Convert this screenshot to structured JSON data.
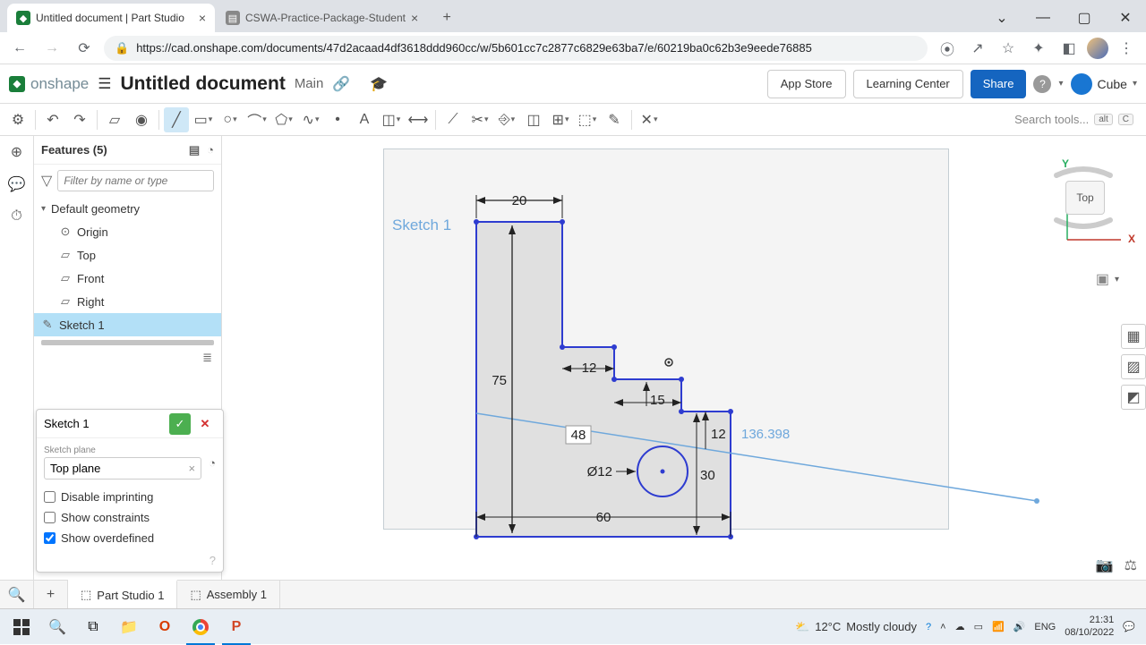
{
  "browser": {
    "tabs": [
      {
        "title": "Untitled document | Part Studio"
      },
      {
        "title": "CSWA-Practice-Package-Student"
      }
    ],
    "url": "https://cad.onshape.com/documents/47d2acaad4df3618ddd960cc/w/5b601cc7c2877c6829e63ba7/e/60219ba0c62b3e9eede76885"
  },
  "header": {
    "brand": "onshape",
    "doc_title": "Untitled document",
    "doc_sub": "Main",
    "app_store": "App Store",
    "learning_center": "Learning Center",
    "share": "Share",
    "user": "Cube"
  },
  "toolbar": {
    "search_placeholder": "Search tools...",
    "hint1": "alt",
    "hint2": "C"
  },
  "features": {
    "title": "Features (5)",
    "filter_placeholder": "Filter by name or type",
    "default_geometry": "Default geometry",
    "items": [
      "Origin",
      "Top",
      "Front",
      "Right"
    ],
    "sketch": "Sketch 1"
  },
  "sketch_dialog": {
    "title": "Sketch 1",
    "sketch_plane_label": "Sketch plane",
    "sketch_plane_value": "Top plane",
    "disable_imprinting": "Disable imprinting",
    "show_constraints": "Show constraints",
    "show_overdefined": "Show overdefined"
  },
  "canvas": {
    "sketch_label": "Sketch 1",
    "dim_20": "20",
    "dim_75": "75",
    "dim_12a": "12",
    "dim_15": "15",
    "dim_48": "48",
    "dim_12b": "12",
    "dim_ref": "136.398",
    "dim_dia": "Ø12",
    "dim_30": "30",
    "dim_60": "60",
    "view_face": "Top",
    "axis_x": "X",
    "axis_y": "Y"
  },
  "bottom_tabs": {
    "part_studio": "Part Studio 1",
    "assembly": "Assembly 1"
  },
  "taskbar": {
    "temp": "12°C",
    "weather": "Mostly cloudy",
    "lang": "ENG",
    "time": "21:31",
    "date": "08/10/2022"
  }
}
